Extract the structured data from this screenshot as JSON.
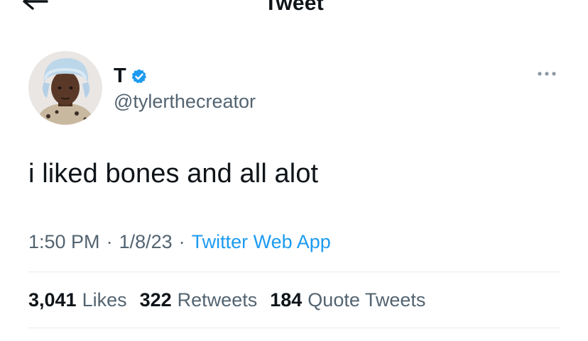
{
  "header": {
    "title": "Tweet",
    "back_icon": "arrow-left-icon"
  },
  "tweet": {
    "author": {
      "name": "T",
      "handle": "@tylerthecreator",
      "verified": true,
      "verified_icon": "verified-badge-icon",
      "avatar_icon": "avatar-photo"
    },
    "more_icon": "more-horizontal-icon",
    "text": "i liked bones and all alot",
    "time": "1:50 PM",
    "separator": "·",
    "date": "1/8/23",
    "source": "Twitter Web App",
    "stats": {
      "likes_count": "3,041",
      "likes_label": "Likes",
      "retweets_count": "322",
      "retweets_label": "Retweets",
      "quotes_count": "184",
      "quotes_label": "Quote Tweets"
    }
  },
  "colors": {
    "accent": "#1d9bf0",
    "text_primary": "#0f1419",
    "text_secondary": "#536471",
    "divider": "#e6e9ec",
    "background": "#ffffff"
  }
}
